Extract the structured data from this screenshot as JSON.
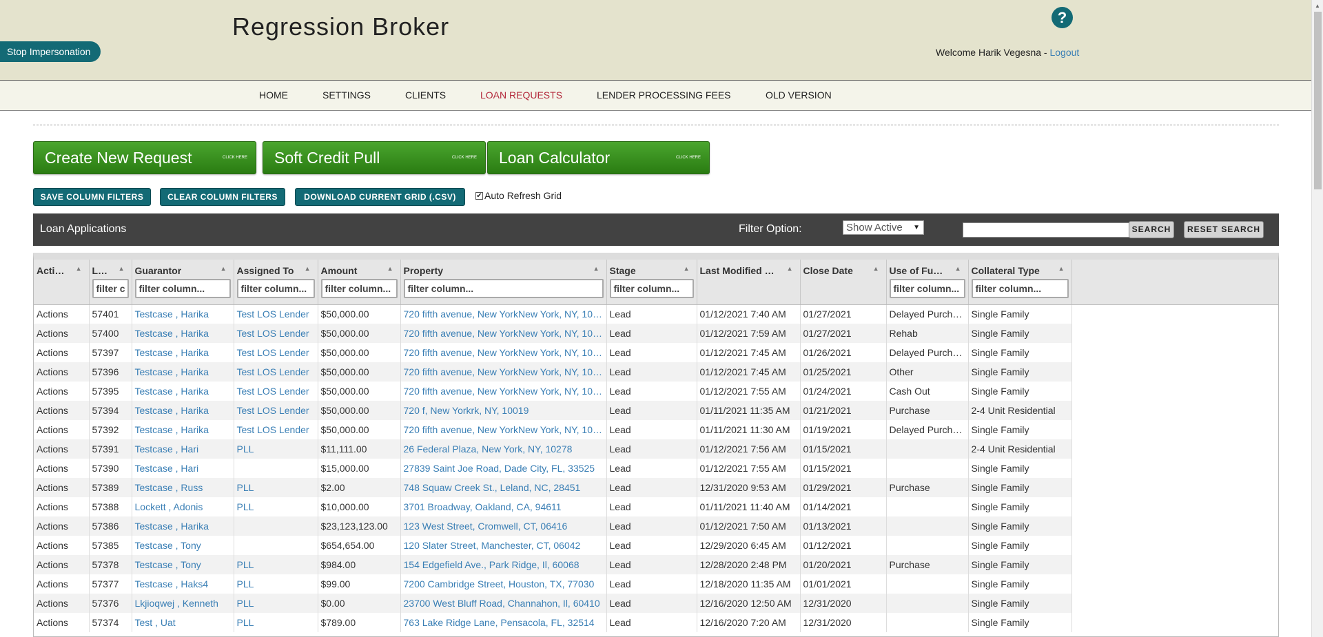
{
  "header": {
    "stop_impersonation": "Stop Impersonation",
    "brand": "Regression Broker",
    "help": "?",
    "welcome": "Welcome Harik Vegesna - ",
    "logout": "Logout"
  },
  "nav": [
    "HOME",
    "SETTINGS",
    "CLIENTS",
    "LOAN REQUESTS",
    "LENDER PROCESSING FEES",
    "OLD VERSION"
  ],
  "actions": {
    "create": "Create New Request",
    "soft": "Soft Credit Pull",
    "calc": "Loan Calculator",
    "click_here": "CLICK HERE",
    "save_filters": "SAVE COLUMN FILTERS",
    "clear_filters": "CLEAR COLUMN FILTERS",
    "download": "DOWNLOAD CURRENT GRID (.CSV)",
    "auto_refresh": "Auto Refresh Grid"
  },
  "grid": {
    "title": "Loan Applications",
    "filter_label": "Filter Option:",
    "filter_value": "Show Active",
    "search_btn": "SEARCH",
    "reset_btn": "RESET SEARCH",
    "columns": [
      {
        "label": "Acti…",
        "filter": ""
      },
      {
        "label": "L…",
        "filter": "filter c"
      },
      {
        "label": "Guarantor",
        "filter": "filter column..."
      },
      {
        "label": "Assigned To",
        "filter": "filter column..."
      },
      {
        "label": "Amount",
        "filter": "filter column..."
      },
      {
        "label": "Property",
        "filter": "filter column..."
      },
      {
        "label": "Stage",
        "filter": "filter column..."
      },
      {
        "label": "Last Modified …",
        "filter": ""
      },
      {
        "label": "Close Date",
        "filter": ""
      },
      {
        "label": "Use of Fu…",
        "filter": "filter column..."
      },
      {
        "label": "Collateral Type",
        "filter": "filter column..."
      }
    ],
    "rows": [
      [
        "Actions",
        "57401",
        "Testcase , Harika",
        "Test LOS Lender",
        "$50,000.00",
        "720 fifth avenue, New YorkNew York, NY, 10…",
        "Lead",
        "01/12/2021 7:40 AM",
        "01/27/2021",
        "Delayed Purch…",
        "Single Family"
      ],
      [
        "Actions",
        "57400",
        "Testcase , Harika",
        "Test LOS Lender",
        "$50,000.00",
        "720 fifth avenue, New YorkNew York, NY, 10…",
        "Lead",
        "01/12/2021 7:59 AM",
        "01/27/2021",
        "Rehab",
        "Single Family"
      ],
      [
        "Actions",
        "57397",
        "Testcase , Harika",
        "Test LOS Lender",
        "$50,000.00",
        "720 fifth avenue, New YorkNew York, NY, 10…",
        "Lead",
        "01/12/2021 7:45 AM",
        "01/26/2021",
        "Delayed Purch…",
        "Single Family"
      ],
      [
        "Actions",
        "57396",
        "Testcase , Harika",
        "Test LOS Lender",
        "$50,000.00",
        "720 fifth avenue, New YorkNew York, NY, 10…",
        "Lead",
        "01/12/2021 7:45 AM",
        "01/25/2021",
        "Other",
        "Single Family"
      ],
      [
        "Actions",
        "57395",
        "Testcase , Harika",
        "Test LOS Lender",
        "$50,000.00",
        "720 fifth avenue, New YorkNew York, NY, 10…",
        "Lead",
        "01/12/2021 7:55 AM",
        "01/24/2021",
        "Cash Out",
        "Single Family"
      ],
      [
        "Actions",
        "57394",
        "Testcase , Harika",
        "Test LOS Lender",
        "$50,000.00",
        "720 f, New Yorkrk, NY, 10019",
        "Lead",
        "01/11/2021 11:35 AM",
        "01/21/2021",
        "Purchase",
        "2-4 Unit Residential"
      ],
      [
        "Actions",
        "57392",
        "Testcase , Harika",
        "Test LOS Lender",
        "$50,000.00",
        "720 fifth avenue, New YorkNew York, NY, 10…",
        "Lead",
        "01/11/2021 11:30 AM",
        "01/19/2021",
        "Delayed Purch…",
        "Single Family"
      ],
      [
        "Actions",
        "57391",
        "Testcase , Hari",
        "PLL",
        "$11,111.00",
        "26 Federal Plaza, New York, NY, 10278",
        "Lead",
        "01/12/2021 7:56 AM",
        "01/15/2021",
        "",
        "2-4 Unit Residential"
      ],
      [
        "Actions",
        "57390",
        "Testcase , Hari",
        "",
        "$15,000.00",
        "27839 Saint Joe Road, Dade City, FL, 33525",
        "Lead",
        "01/12/2021 7:55 AM",
        "01/15/2021",
        "",
        "Single Family"
      ],
      [
        "Actions",
        "57389",
        "Testcase , Russ",
        "PLL",
        "$2.00",
        "748 Squaw Creek St., Leland, NC, 28451",
        "Lead",
        "12/31/2020 9:53 AM",
        "01/29/2021",
        "Purchase",
        "Single Family"
      ],
      [
        "Actions",
        "57388",
        "Lockett , Adonis",
        "PLL",
        "$10,000.00",
        "3701 Broadway, Oakland, CA, 94611",
        "Lead",
        "01/11/2021 11:40 AM",
        "01/14/2021",
        "",
        "Single Family"
      ],
      [
        "Actions",
        "57386",
        "Testcase , Harika",
        "",
        "$23,123,123.00",
        "123 West Street, Cromwell, CT, 06416",
        "Lead",
        "01/12/2021 7:50 AM",
        "01/13/2021",
        "",
        "Single Family"
      ],
      [
        "Actions",
        "57385",
        "Testcase , Tony",
        "",
        "$654,654.00",
        "120 Slater Street, Manchester, CT, 06042",
        "Lead",
        "12/29/2020 6:45 AM",
        "01/12/2021",
        "",
        "Single Family"
      ],
      [
        "Actions",
        "57378",
        "Testcase , Tony",
        "PLL",
        "$984.00",
        "154 Edgefield Ave., Park Ridge, Il, 60068",
        "Lead",
        "12/28/2020 2:48 PM",
        "01/20/2021",
        "Purchase",
        "Single Family"
      ],
      [
        "Actions",
        "57377",
        "Testcase , Haks4",
        "PLL",
        "$99.00",
        "7200 Cambridge Street, Houston, TX, 77030",
        "Lead",
        "12/18/2020 11:35 AM",
        "01/01/2021",
        "",
        "Single Family"
      ],
      [
        "Actions",
        "57376",
        "Lkjioqwej , Kenneth",
        "PLL",
        "$0.00",
        "23700 West Bluff Road, Channahon, Il, 60410",
        "Lead",
        "12/16/2020 12:50 AM",
        "12/31/2020",
        "",
        "Single Family"
      ],
      [
        "Actions",
        "57374",
        "Test , Uat",
        "PLL",
        "$789.00",
        "763 Lake Ridge Lane, Pensacola, FL, 32514",
        "Lead",
        "12/16/2020 7:20 AM",
        "12/31/2020",
        "",
        "Single Family"
      ]
    ]
  }
}
